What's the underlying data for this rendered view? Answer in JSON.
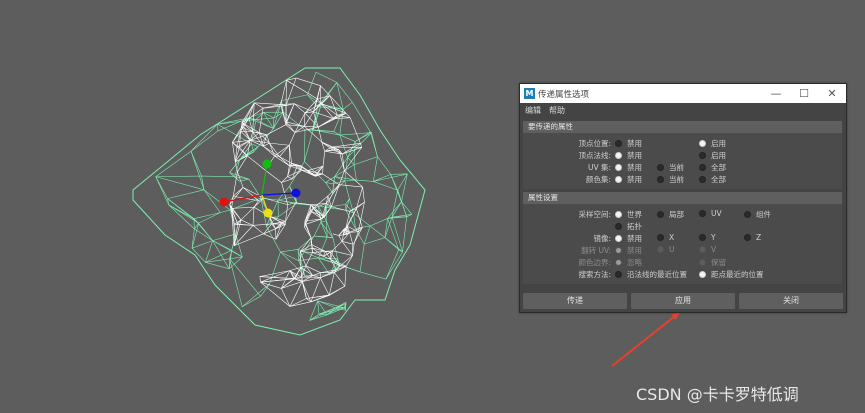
{
  "window": {
    "title": "传递属性选项",
    "app_icon": "M",
    "min_glyph": "—",
    "max_glyph": "☐",
    "close_glyph": "✕"
  },
  "menu": {
    "items": [
      "编辑",
      "帮助"
    ]
  },
  "sections": [
    {
      "header": "要传递的属性",
      "rows": [
        {
          "label": "顶点位置:",
          "options": [
            {
              "text": "禁用",
              "selected": false
            },
            {
              "text": "启用",
              "selected": true
            }
          ]
        },
        {
          "label": "顶点法线:",
          "options": [
            {
              "text": "禁用",
              "selected": true
            },
            {
              "text": "启用",
              "selected": false
            }
          ]
        },
        {
          "label": "UV 集:",
          "options": [
            {
              "text": "禁用",
              "selected": true
            },
            {
              "text": "当前",
              "selected": false
            },
            {
              "text": "全部",
              "selected": false
            }
          ]
        },
        {
          "label": "颜色集:",
          "options": [
            {
              "text": "禁用",
              "selected": true
            },
            {
              "text": "当前",
              "selected": false
            },
            {
              "text": "全部",
              "selected": false
            }
          ]
        }
      ]
    },
    {
      "header": "属性设置",
      "rows": [
        {
          "label": "采样空间:",
          "options": [
            {
              "text": "世界",
              "selected": true
            },
            {
              "text": "局部",
              "selected": false
            },
            {
              "text": "UV",
              "selected": false
            },
            {
              "text": "组件",
              "selected": false
            },
            {
              "text": "拓扑",
              "selected": false
            }
          ]
        },
        {
          "label": "镜像:",
          "options": [
            {
              "text": "禁用",
              "selected": true
            },
            {
              "text": "X",
              "selected": false
            },
            {
              "text": "Y",
              "selected": false
            },
            {
              "text": "Z",
              "selected": false
            }
          ]
        },
        {
          "label": "翻转 UV:",
          "disabled": true,
          "options": [
            {
              "text": "禁用",
              "selected": true
            },
            {
              "text": "U",
              "selected": false
            },
            {
              "text": "V",
              "selected": false
            }
          ]
        },
        {
          "label": "颜色边界:",
          "disabled": true,
          "options": [
            {
              "text": "忽略",
              "selected": true
            },
            {
              "text": "保留",
              "selected": false
            }
          ]
        },
        {
          "label": "搜索方法:",
          "options": [
            {
              "text": "沿法线的最近位置",
              "selected": false
            },
            {
              "text": "距点最近的位置",
              "selected": true
            }
          ]
        }
      ]
    }
  ],
  "buttons": {
    "transfer": "传递",
    "apply": "应用",
    "close": "关闭"
  },
  "watermark": "CSDN @卡卡罗特低调",
  "colors": {
    "viewport_bg": "#5d5d5d",
    "wire_outer": "#7ef0b0",
    "wire_inner": "#ffffff",
    "annotation_arrow": "#e8402a",
    "gizmo_red": "#e01010",
    "gizmo_green": "#10c010",
    "gizmo_blue": "#1010e0",
    "gizmo_yellow": "#e8e010"
  }
}
